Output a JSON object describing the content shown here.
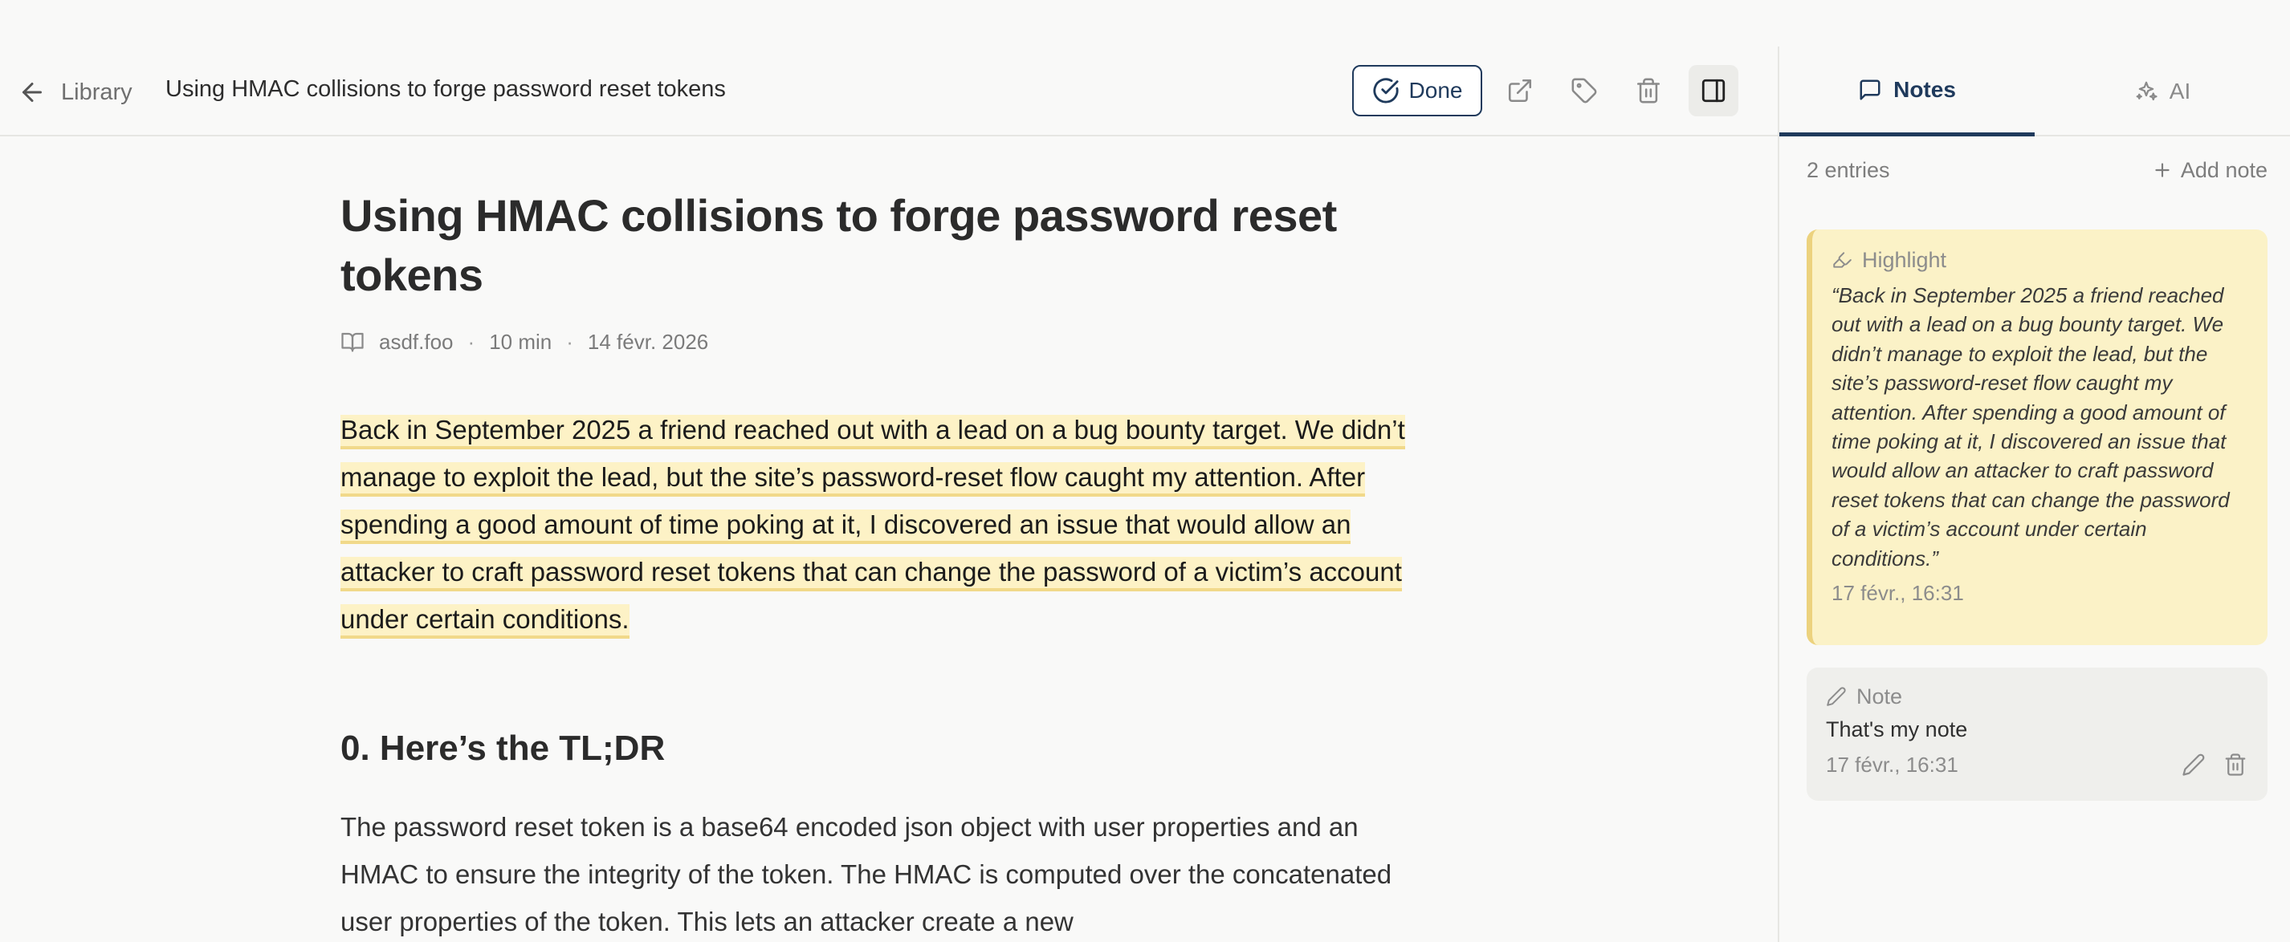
{
  "topbar": {
    "back_label": "Library",
    "title": "Using HMAC collisions to forge password reset tokens",
    "done_label": "Done",
    "icons": [
      "external-link-icon",
      "tag-icon",
      "trash-icon",
      "sidebar-toggle-icon"
    ]
  },
  "article": {
    "title": "Using HMAC collisions to forge password reset tokens",
    "meta": {
      "source": "asdf.foo",
      "read_time": "10 min",
      "date": "14 févr. 2026"
    },
    "highlighted_paragraph": "Back in September 2025 a friend reached out with a lead on a bug bounty target. We didn’t manage to exploit the lead, but the site’s password-reset flow caught my attention. After spending a good amount of time poking at it, I discovered an issue that would allow an attacker to craft password reset tokens that can change the password of a victim’s account under certain conditions.",
    "section_heading": "0. Here’s the TL;DR",
    "paragraph": "The password reset token is a base64 encoded json object with user properties and an HMAC to ensure the integrity of the token. The HMAC is computed over the concatenated user properties of the token. This lets an attacker create a new"
  },
  "panel": {
    "tabs": [
      {
        "label": "Notes",
        "active": true
      },
      {
        "label": "AI",
        "active": false
      }
    ],
    "entries_count": "2 entries",
    "add_note_label": "Add note",
    "highlight_card": {
      "type_label": "Highlight",
      "quote": "“Back in September 2025 a friend reached out with a lead on a bug bounty target. We didn’t manage to exploit the lead, but the site’s password-reset flow caught my attention. After spending a good amount of time poking at it, I discovered an issue that would allow an attacker to craft password reset tokens that can change the password of a victim’s account under certain conditions.”",
      "timestamp": "17 févr., 16:31"
    },
    "note_card": {
      "type_label": "Note",
      "text": "That's my note",
      "timestamp": "17 févr., 16:31"
    }
  },
  "colors": {
    "accent": "#1f3a5c",
    "highlight_bg": "#fdf2c6",
    "highlight_border": "#f1d98a",
    "page_bg": "#f9f9f8"
  }
}
